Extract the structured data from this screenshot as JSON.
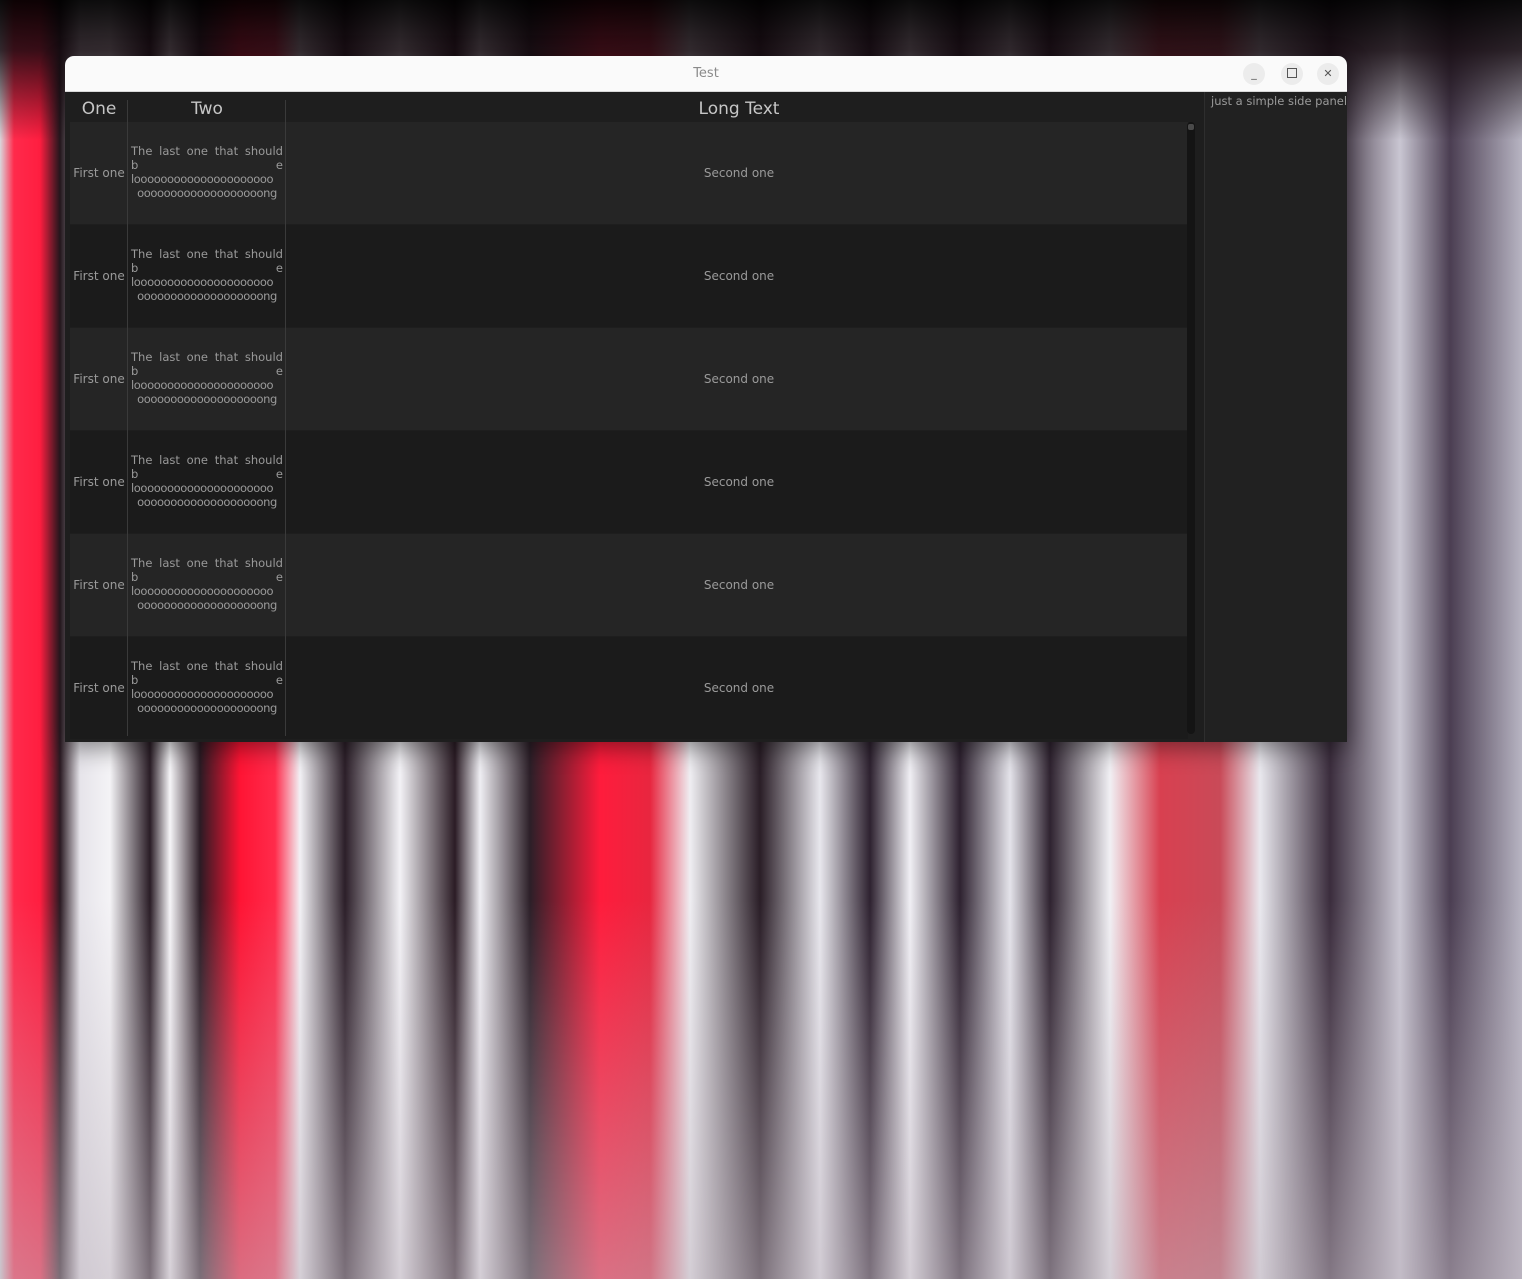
{
  "window": {
    "title": "Test",
    "minimize_label": "_",
    "close_label": "✕"
  },
  "table": {
    "headers": [
      "One",
      "Two",
      "Long Text"
    ],
    "rows": [
      {
        "one": "First one",
        "two_line1_words": [
          "The",
          "last",
          "one",
          "that",
          "should"
        ],
        "two_line2_left": "b",
        "two_line2_right": "e",
        "two_line3": "looooooooooooooooooooo",
        "two_line4": "ooooooooooooooooooong",
        "three": "Second one"
      },
      {
        "one": "First one",
        "two_line1_words": [
          "The",
          "last",
          "one",
          "that",
          "should"
        ],
        "two_line2_left": "b",
        "two_line2_right": "e",
        "two_line3": "looooooooooooooooooooo",
        "two_line4": "ooooooooooooooooooong",
        "three": "Second one"
      },
      {
        "one": "First one",
        "two_line1_words": [
          "The",
          "last",
          "one",
          "that",
          "should"
        ],
        "two_line2_left": "b",
        "two_line2_right": "e",
        "two_line3": "looooooooooooooooooooo",
        "two_line4": "ooooooooooooooooooong",
        "three": "Second one"
      },
      {
        "one": "First one",
        "two_line1_words": [
          "The",
          "last",
          "one",
          "that",
          "should"
        ],
        "two_line2_left": "b",
        "two_line2_right": "e",
        "two_line3": "looooooooooooooooooooo",
        "two_line4": "ooooooooooooooooooong",
        "three": "Second one"
      },
      {
        "one": "First one",
        "two_line1_words": [
          "The",
          "last",
          "one",
          "that",
          "should"
        ],
        "two_line2_left": "b",
        "two_line2_right": "e",
        "two_line3": "looooooooooooooooooooo",
        "two_line4": "ooooooooooooooooooong",
        "three": "Second one"
      },
      {
        "one": "First one",
        "two_line1_words": [
          "The",
          "last",
          "one",
          "that",
          "should"
        ],
        "two_line2_left": "b",
        "two_line2_right": "e",
        "two_line3": "looooooooooooooooooooo",
        "two_line4": "ooooooooooooooooooong",
        "three": "Second one"
      }
    ]
  },
  "side_panel": {
    "text": "just a simple side panel"
  },
  "icons": {
    "minimize": "minimize-icon",
    "maximize": "maximize-icon",
    "close": "close-icon"
  }
}
